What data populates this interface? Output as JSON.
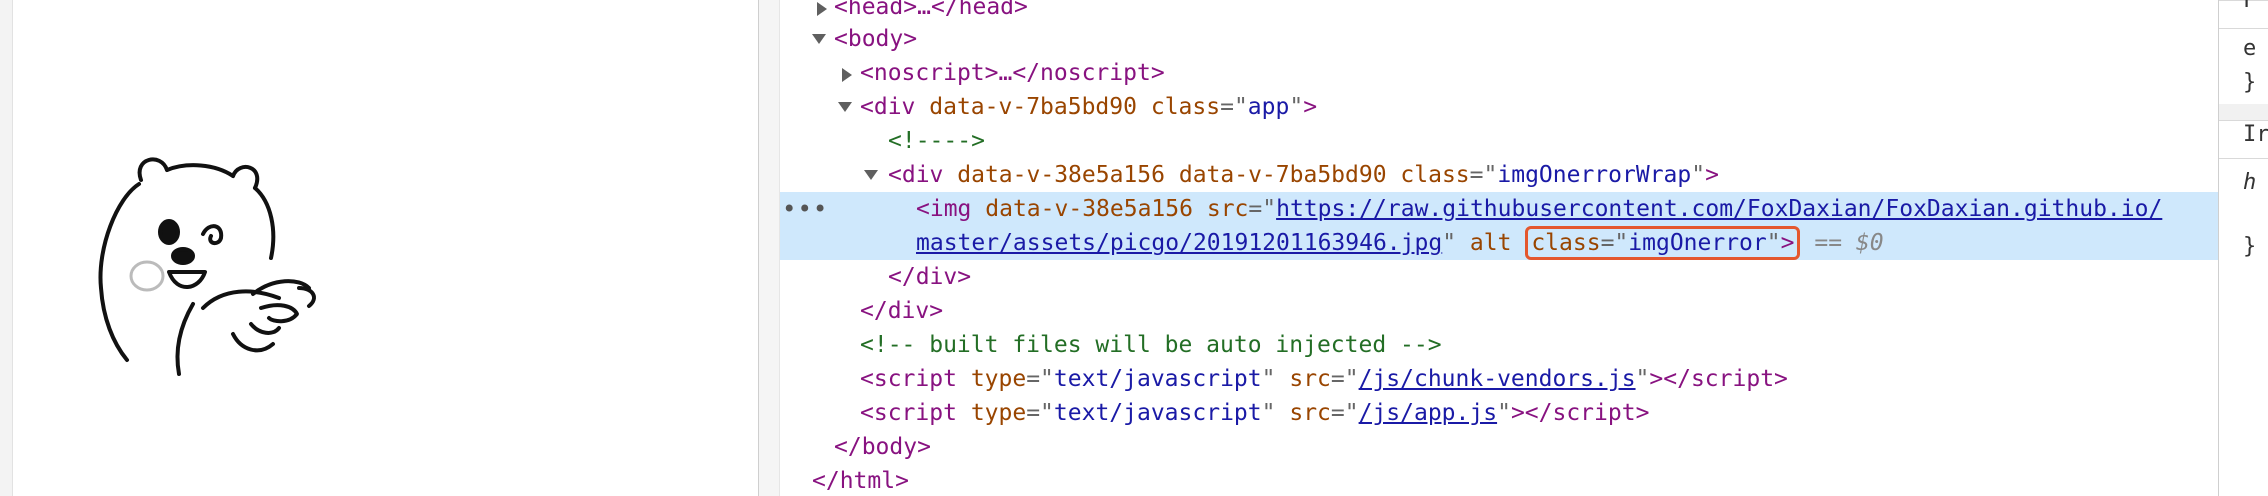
{
  "preview": {
    "image_alt": "cartoon bear pointing"
  },
  "tree": {
    "head_line": [
      "<",
      "head",
      ">…</",
      "head",
      ">"
    ],
    "body_open": [
      "<",
      "body",
      ">"
    ],
    "noscript_line": [
      "<",
      "noscript",
      ">…</",
      "noscript",
      ">"
    ],
    "app_div": {
      "open": "<",
      "tag": "div",
      "attr1": "data-v-7ba5bd90",
      "attr2_name": "class",
      "attr2_value": "app",
      "close": ">"
    },
    "comment_empty": "<!---->",
    "wrap_div": {
      "open": "<",
      "tag": "div",
      "attr1": "data-v-38e5a156",
      "attr2": "data-v-7ba5bd90",
      "attr3_name": "class",
      "attr3_value": "imgOnerrorWrap",
      "close": ">"
    },
    "selected_img": {
      "ellipsis": "•••",
      "open": "<",
      "tag": "img",
      "attr1": "data-v-38e5a156",
      "src_name": "src",
      "src_part1": "https://raw.githubusercontent.com/FoxDaxian/FoxDaxian.github.io/",
      "src_part2": "master/assets/picgo/20191201163946.jpg",
      "alt_name": "alt",
      "class_name": "class",
      "class_value": "imgOnerror",
      "close": ">",
      "console_ref": "== $0"
    },
    "wrap_div_close": "</div>",
    "app_div_close": "</div>",
    "comment_built": "<!-- built files will be auto injected -->",
    "script1": {
      "tag": "script",
      "type_name": "type",
      "type_value": "text/javascript",
      "src_name": "src",
      "src_value": "/js/chunk-vendors.js",
      "end_tag": "script"
    },
    "script2": {
      "tag": "script",
      "type_name": "type",
      "type_value": "text/javascript",
      "src_name": "src",
      "src_value": "/js/app.js",
      "end_tag": "script"
    },
    "body_close": "</body>",
    "html_close": "</html>"
  },
  "styles_pane": {
    "line1": "F",
    "line2": "e",
    "line3": "}",
    "line4": "Ir",
    "line5": "h",
    "line6": "}"
  },
  "colors": {
    "tag": "#881280",
    "attr_name": "#994500",
    "attr_value": "#1a1aa6",
    "comment": "#236e25",
    "selection_bg": "#cfe8fc",
    "highlight_box": "#e4572e"
  }
}
